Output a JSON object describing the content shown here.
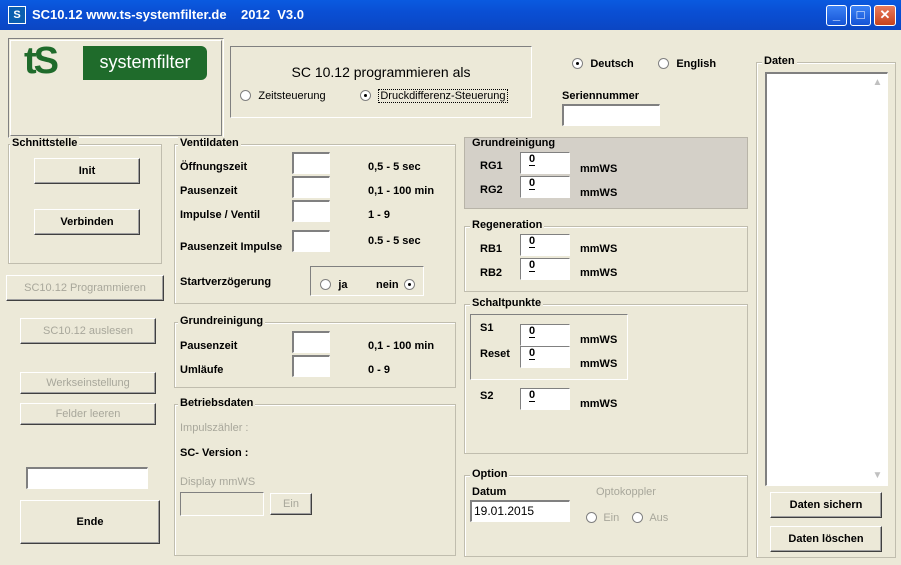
{
  "window": {
    "title": "SC10.12 www.ts-systemfilter.de    2012  V3.0",
    "icon_letter": "S",
    "minimize_glyph": "_",
    "maximize_glyph": "□",
    "close_glyph": "✕"
  },
  "logo": {
    "mark": "tS",
    "text": "systemfilter"
  },
  "mode": {
    "heading": "SC 10.12 programmieren als",
    "options": [
      {
        "label": "Zeitsteuerung",
        "selected": false
      },
      {
        "label": "Druckdifferenz-Steuerung",
        "selected": true
      }
    ]
  },
  "language": {
    "options": [
      {
        "label": "Deutsch",
        "selected": true
      },
      {
        "label": "English",
        "selected": false
      }
    ],
    "serial_label": "Seriennummer",
    "serial_value": ""
  },
  "schnittstelle": {
    "legend": "Schnittstelle",
    "init": "Init",
    "verbinden": "Verbinden"
  },
  "left_buttons": {
    "programmieren": "SC10.12 Programmieren",
    "auslesen": "SC10.12 auslesen",
    "werkseinstellung": "Werkseinstellung",
    "felder_leeren": "Felder leeren",
    "status_value": "",
    "ende": "Ende"
  },
  "ventildaten": {
    "legend": "Ventildaten",
    "rows": [
      {
        "label": "Öffnungszeit",
        "range": "0,5 - 5 sec",
        "value": ""
      },
      {
        "label": "Pausenzeit",
        "range": "0,1 - 100 min",
        "value": ""
      },
      {
        "label": "Impulse / Ventil",
        "range": "1 - 9",
        "value": ""
      },
      {
        "label": "Pausenzeit Impulse",
        "range": "0.5 - 5 sec",
        "value": ""
      }
    ],
    "start_label": "Startverzögerung",
    "start_ja": "ja",
    "start_nein": "nein"
  },
  "grundreinigung_left": {
    "legend": "Grundreinigung",
    "rows": [
      {
        "label": "Pausenzeit",
        "range": "0,1 - 100 min",
        "value": ""
      },
      {
        "label": "Umläufe",
        "range": "0 - 9",
        "value": ""
      }
    ]
  },
  "betriebsdaten": {
    "legend": "Betriebsdaten",
    "impulszaehler": "Impulszähler :",
    "sc_version": "SC- Version :",
    "display_label": "Display mmWS",
    "display_value": "",
    "ein_button": "Ein"
  },
  "grundreinigung_right": {
    "legend": "Grundreinigung",
    "rows": [
      {
        "label": "RG1",
        "value": "0",
        "unit": "mmWS"
      },
      {
        "label": "RG2",
        "value": "0",
        "unit": "mmWS"
      }
    ]
  },
  "regeneration": {
    "legend": "Regeneration",
    "rows": [
      {
        "label": "RB1",
        "value": "0",
        "unit": "mmWS"
      },
      {
        "label": "RB2",
        "value": "0",
        "unit": "mmWS"
      }
    ]
  },
  "schaltpunkte": {
    "legend": "Schaltpunkte",
    "rows": [
      {
        "label": "S1",
        "value": "0",
        "unit": "mmWS"
      },
      {
        "label": "Reset",
        "value": "0",
        "unit": "mmWS"
      },
      {
        "label": "S2",
        "value": "0",
        "unit": "mmWS"
      }
    ]
  },
  "option": {
    "legend": "Option",
    "datum_label": "Datum",
    "datum_value": "19.01.2015",
    "optokoppler_label": "Optokoppler",
    "opto_ein": "Ein",
    "opto_aus": "Aus"
  },
  "daten": {
    "legend": "Daten",
    "sichern": "Daten sichern",
    "loeschen": "Daten löschen",
    "scroll_up_glyph": "▲",
    "scroll_down_glyph": "▼"
  }
}
